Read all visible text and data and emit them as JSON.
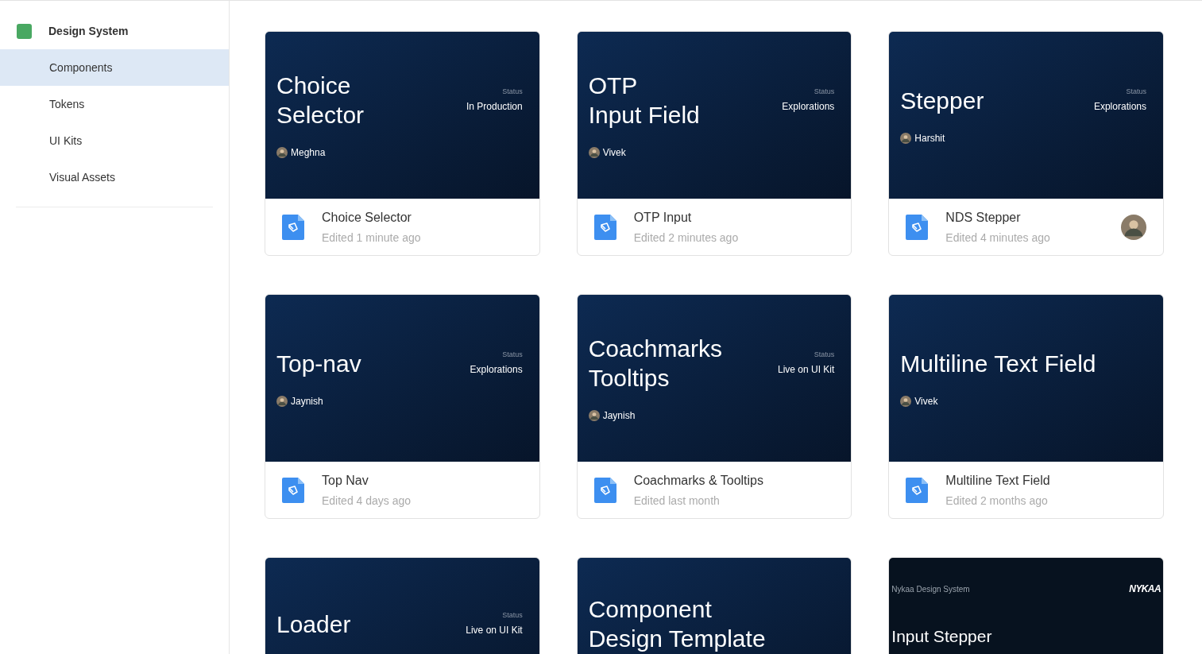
{
  "sidebar": {
    "title": "Design System",
    "items": [
      {
        "label": "Components",
        "selected": true
      },
      {
        "label": "Tokens",
        "selected": false
      },
      {
        "label": "UI Kits",
        "selected": false
      },
      {
        "label": "Visual Assets",
        "selected": false
      }
    ]
  },
  "cards": [
    {
      "kind": "cover",
      "title": [
        "Choice",
        "Selector"
      ],
      "status_label": "Status",
      "status": "In Production",
      "author": "Meghna",
      "name": "Choice Selector",
      "edited": "Edited 1 minute ago",
      "avatar": false
    },
    {
      "kind": "cover",
      "title": [
        "OTP",
        "Input Field"
      ],
      "status_label": "Status",
      "status": "Explorations",
      "author": "Vivek",
      "name": "OTP Input",
      "edited": "Edited 2 minutes ago",
      "avatar": false
    },
    {
      "kind": "cover",
      "title": [
        "Stepper"
      ],
      "status_label": "Status",
      "status": "Explorations",
      "author": "Harshit",
      "name": "NDS Stepper",
      "edited": "Edited 4 minutes ago",
      "avatar": true
    },
    {
      "kind": "cover",
      "title": [
        "Top-nav"
      ],
      "status_label": "Status",
      "status": "Explorations",
      "author": "Jaynish",
      "name": "Top Nav",
      "edited": "Edited 4 days ago",
      "avatar": false
    },
    {
      "kind": "cover",
      "title": [
        "Coachmarks",
        "Tooltips"
      ],
      "status_label": "Status",
      "status": "Live on UI Kit",
      "author": "Jaynish",
      "name": "Coachmarks & Tooltips",
      "edited": "Edited last month",
      "avatar": false
    },
    {
      "kind": "cover",
      "title": [
        "Multiline Text Field"
      ],
      "author": "Vivek",
      "name": "Multiline Text Field",
      "edited": "Edited 2 months ago",
      "avatar": false
    },
    {
      "kind": "cover",
      "title": [
        "Loader"
      ],
      "status_label": "Status",
      "status": "Live on UI Kit"
    },
    {
      "kind": "cover",
      "title": [
        "Component",
        "Design Template"
      ]
    },
    {
      "kind": "brand",
      "header": "Nykaa Design System",
      "logo": "NYKAA",
      "title": [
        "Input Stepper"
      ]
    }
  ]
}
